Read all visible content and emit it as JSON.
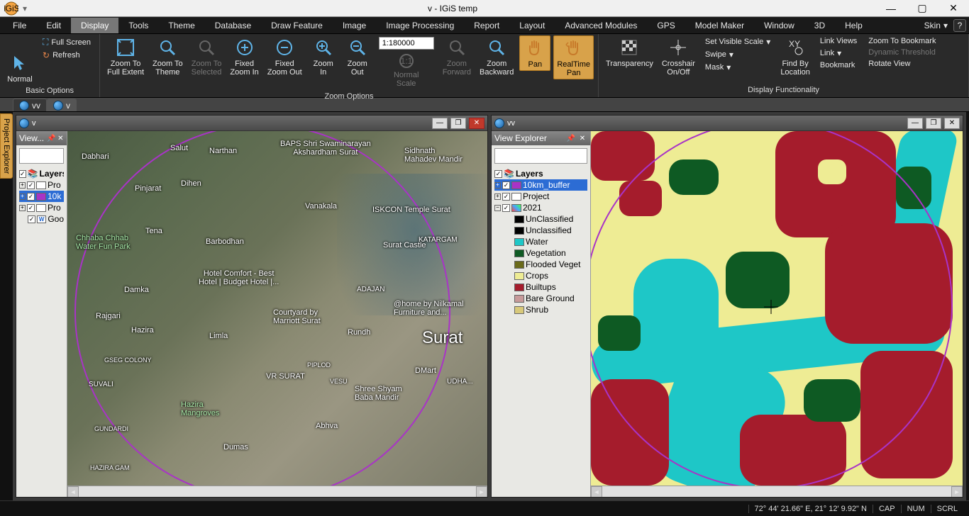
{
  "app": {
    "title": "v - IGiS temp"
  },
  "menus": [
    "File",
    "Edit",
    "Display",
    "Tools",
    "Theme",
    "Database",
    "Draw Feature",
    "Image",
    "Image Processing",
    "Report",
    "Layout",
    "Advanced Modules",
    "GPS",
    "Model Maker",
    "Window",
    "3D",
    "Help"
  ],
  "menu_active_index": 2,
  "skin_label": "Skin",
  "ribbon": {
    "basic": {
      "label": "Basic Options",
      "normal": "Normal",
      "fullscreen": "Full Screen",
      "refresh": "Refresh"
    },
    "zoom": {
      "label": "Zoom Options",
      "full_extent": "Zoom To\nFull Extent",
      "theme": "Zoom To\nTheme",
      "selected": "Zoom To\nSelected",
      "fixed_in": "Fixed\nZoom In",
      "fixed_out": "Fixed\nZoom Out",
      "in": "Zoom\nIn",
      "out": "Zoom\nOut",
      "scale": "1:180000",
      "normal_scale": "Normal\nScale",
      "forward": "Zoom\nForward",
      "backward": "Zoom\nBackward",
      "pan": "Pan",
      "realtime": "RealTime\nPan"
    },
    "display": {
      "label": "Display Functionality",
      "transparency": "Transparency",
      "crosshair": "Crosshair\nOn/Off",
      "visible_scale": "Set Visible Scale",
      "swipe": "Swipe",
      "mask": "Mask",
      "find_by_loc": "Find By\nLocation",
      "link_views": "Link Views",
      "link": "Link",
      "bookmark": "Bookmark",
      "zoom_bookmark": "Zoom To Bookmark",
      "dyn_threshold": "Dynamic Threshold",
      "rotate": "Rotate View"
    }
  },
  "tabs": [
    "vv",
    "v"
  ],
  "left_win": {
    "title": "v",
    "explorer_title": "View...",
    "layers_root": "Layers",
    "layers": [
      "Pro",
      "10k",
      "Pro",
      "Goo"
    ],
    "map_labels": {
      "dabhari": "Dabhari",
      "salut": "Salut",
      "narthan": "Narthan",
      "baps": "BAPS Shri Swaminarayan\nAkshardham Surat",
      "sidhnath": "Sidhnath\nMahadev Mandir",
      "pinjarat": "Pinjarat",
      "dihen": "Dihen",
      "chhab": "Chhaba Chhab\nWater Fun Park",
      "tena": "Tena",
      "vanakala": "Vanakala",
      "iskcon": "ISKCON Temple Surat",
      "barbodhan": "Barbodhan",
      "castle": "Surat Castle",
      "katargam": "KATARGAM",
      "damka": "Damka",
      "comfort": "Hotel Comfort - Best\nHotel | Budget Hotel |...",
      "adajan": "ADAJAN",
      "nilkamal": "@home by Nilkamal\nFurniture and...",
      "rajgari": "Rajgari",
      "hazira": "Hazira",
      "limla": "Limla",
      "courtyard": "Courtyard by\nMarriott Surat",
      "rundh": "Rundh",
      "surat": "Surat",
      "gseg": "GSEG COLONY",
      "vrsurat": "VR SURAT",
      "vesu": "VESU",
      "dmart": "DMart",
      "udha": "UDHA...",
      "suvali": "SUVALI",
      "shree": "Shree Shyam\nBaba Mandir",
      "mangroves": "Hazira\nMangroves",
      "abhva": "Abhva",
      "gundardi": "GUNDARDI",
      "dumas": "Dumas",
      "haziragam": "HAZIRA GAM",
      "piplod": "PIPLOD"
    }
  },
  "right_win": {
    "title": "vv",
    "explorer_title": "View Explorer",
    "layers_root": "Layers",
    "buffer": "10km_buffer",
    "project": "Project",
    "year": "2021",
    "classes": [
      {
        "name": "UnClassified",
        "color": "#000000"
      },
      {
        "name": "Unclassified",
        "color": "#000000"
      },
      {
        "name": "Water",
        "color": "#1ec7c7"
      },
      {
        "name": "Vegetation",
        "color": "#0e5a23"
      },
      {
        "name": "Flooded Veget",
        "color": "#6a6a1a"
      },
      {
        "name": "Crops",
        "color": "#eeec94"
      },
      {
        "name": "Builtups",
        "color": "#a51c2c"
      },
      {
        "name": "Bare Ground",
        "color": "#c79a9a"
      },
      {
        "name": "Shrub",
        "color": "#d8c97a"
      }
    ]
  },
  "status": {
    "coords": "72° 44' 21.66\" E,  21° 12' 9.92\" N",
    "cap": "CAP",
    "num": "NUM",
    "scrl": "SCRL"
  },
  "side_tab": "Project Explorer"
}
